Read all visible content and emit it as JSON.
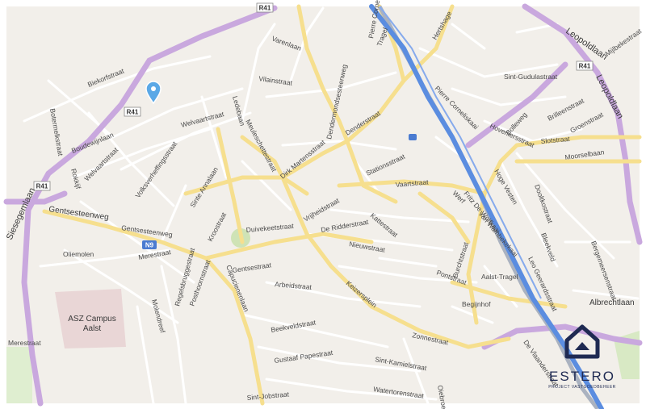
{
  "map": {
    "background_color": "#f2efea",
    "roads": {
      "minor_color": "#ffffff",
      "main_color": "#f6df8e",
      "motorway_color": "#c9a8de",
      "rail_color": "#9aa5b8",
      "river_color": "#5b8de0"
    },
    "street_labels": [
      "Varenlaan",
      "Vilainstraat",
      "Welvaartstraat",
      "Ledebaan",
      "Biekorfstraat",
      "Botermelkstraat",
      "Boudewijnlaan",
      "Rokkijf",
      "Welvaartstraat",
      "Volksverheffingsstraat",
      "Sinte Annalaan",
      "Meuleschettestraat",
      "Dirk Martensstraat",
      "Denderstraat",
      "Stationsstraat",
      "Dendermondsesteenweg",
      "Pierre Corneliskaai",
      "Tragel",
      "Hertshage",
      "Sint-Gudulastraat",
      "Pierre Corneliskaai",
      "Bolleweg",
      "Hoveniersstraat",
      "Slotstraat",
      "Groenstraat",
      "Mijlbekestraat",
      "Brilleenstraat",
      "Moorselbaan",
      "Hoge Vesten",
      "Dooltkostraat",
      "Vaartstraat",
      "Werf",
      "Fritz De Wolfkaai",
      "Van Wambekekaai",
      "Vrijheidstraat",
      "Kattestraat",
      "De Ridderstraat",
      "Nieuwstraat",
      "Burchtstraat",
      "Duivekeetstraat",
      "Kroostraat",
      "Gentsesteenweg",
      "Gentsestraat",
      "Arbeidstraat",
      "Keizersplein",
      "Pontstraat",
      "Aalst-Tragel",
      "Begijnhof",
      "Leo Geerardsstraat",
      "Bleekveld",
      "Bergemeersenstraat",
      "Albrechtlaan",
      "Oliemolen",
      "Merestraat",
      "Regelsbruggestraat",
      "Posthoornstraat",
      "Capucienenlaan",
      "Molendreef",
      "Beekveldstraat",
      "Gustaaf Papestraat",
      "Sint-Jobstraat",
      "Sint-Kamielstraat",
      "Watertorenstraat",
      "Oiebroek",
      "Zonnestraat",
      "De Vlaanderstraat",
      "Merestraat"
    ],
    "major_labels": [
      "Leopoldlaan",
      "Leopoldlaan",
      "Siesegemlaan",
      "Gentsesteenweg"
    ],
    "road_shields": [
      {
        "text": "R41",
        "type": "ring"
      },
      {
        "text": "R41",
        "type": "ring"
      },
      {
        "text": "R41",
        "type": "ring"
      },
      {
        "text": "R41",
        "type": "ring"
      },
      {
        "text": "N9",
        "type": "national"
      }
    ],
    "pois": [
      {
        "label": "ASZ Campus Aalst",
        "line1": "ASZ Campus",
        "line2": "Aalst"
      }
    ],
    "marker": {
      "icon": "map-pin-icon",
      "color": "#5aa8e6"
    }
  },
  "logo": {
    "brand": "ESTERO",
    "tagline": "PROJECT VASTGOEDBEHEER",
    "color": "#1f2a52"
  }
}
